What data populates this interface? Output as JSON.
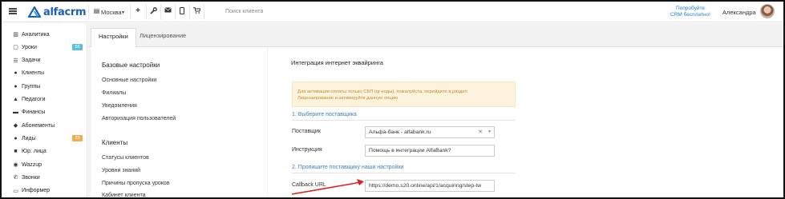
{
  "topbar": {
    "logo_text": "alfacrm",
    "branch": "Москва",
    "search_placeholder": "Поиск клиента",
    "promo_line1": "Попробуйте",
    "promo_line2": "CRM бесплатно!",
    "user_name": "Александра",
    "icons": [
      "plus-icon",
      "wrench-icon",
      "mail-icon",
      "phone-icon",
      "cart-icon"
    ]
  },
  "sidebar": {
    "items": [
      {
        "label": "Аналитика",
        "icon": "chart-icon"
      },
      {
        "label": "Уроки",
        "icon": "calendar-icon",
        "badge": "55",
        "badge_color": "#5bc0de"
      },
      {
        "label": "Задачи",
        "icon": "tasks-icon"
      },
      {
        "label": "Клиенты",
        "icon": "user-icon"
      },
      {
        "label": "Группы",
        "icon": "users-icon"
      },
      {
        "label": "Педагоги",
        "icon": "graduation-cap-icon"
      },
      {
        "label": "Финансы",
        "icon": "money-icon"
      },
      {
        "label": "Абонементы",
        "icon": "tag-icon"
      },
      {
        "label": "Лиды",
        "icon": "leads-icon",
        "badge": "23",
        "badge_color": "#f0ad4e"
      },
      {
        "label": "Юр. лица",
        "icon": "briefcase-icon"
      },
      {
        "label": "Wazzup",
        "icon": "whatsapp-icon"
      },
      {
        "label": "Звонки",
        "icon": "phone-call-icon"
      },
      {
        "label": "Информер",
        "icon": "informer-icon"
      }
    ]
  },
  "tabs": [
    "Настройки",
    "Лицензирование"
  ],
  "settings_nav": {
    "heading1": "Базовые настройки",
    "links1": [
      "Основные настройки",
      "Филиалы",
      "Уведомления",
      "Авторизация пользователей"
    ],
    "heading2": "Клиенты",
    "links2": [
      "Статусы клиентов",
      "Уровни знаний",
      "Причины пропуска уроков",
      "Кабинет клиента"
    ]
  },
  "form": {
    "title": "Интеграция интернет эквайринга",
    "alert_line1": "Для активации оплаты только СБП (qr-коды), пожалуйста, перейдите в раздел",
    "alert_line2": "Лицензирование и активируйте данную опцию",
    "step1": "1. Выберите поставщика",
    "provider_label": "Поставщик",
    "provider_value": "Альфа-банк - alfabank.ru",
    "instruction_label": "Инструкция",
    "instruction_value": "Помощь в интеграции AlfaBank?",
    "step2": "2. Пропишите поставщику наши настройки",
    "callback_label": "Callback URL",
    "callback_value": "https://demo.s20.online/api/1/acquiring/step-tw"
  }
}
